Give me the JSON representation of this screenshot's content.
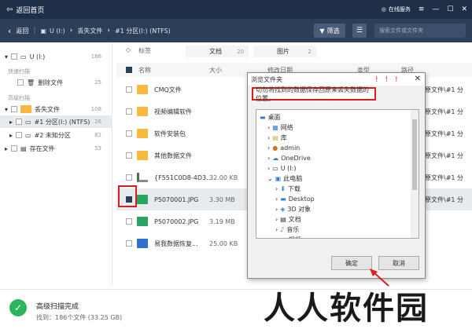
{
  "topbar": {
    "back_label": "返回首页",
    "service_label": "在线服务"
  },
  "navbar": {
    "back": "返回",
    "crumbs": [
      "U (I:)",
      "丢失文件",
      "#1 分区(I:) (NTFS)"
    ],
    "filter": "筛选",
    "search_placeholder": "搜索文件或文件夹"
  },
  "sidebar": {
    "drive": {
      "label": "U (I:)",
      "count": "186"
    },
    "quick_title": "快速扫描",
    "deleted": {
      "label": "删除文件",
      "count": "25"
    },
    "advanced_title": "高级扫描",
    "lost": {
      "label": "丢失文件",
      "count": "108"
    },
    "part1": {
      "label": "#1 分区(I:) (NTFS)",
      "count": "26"
    },
    "part2": {
      "label": "#2 未知分区",
      "count": "82"
    },
    "existing": {
      "label": "存在文件",
      "count": "53"
    }
  },
  "tabs": {
    "tag": "标签",
    "doc": "文档",
    "doc_count": "20",
    "pic": "图片",
    "pic_count": "2"
  },
  "columns": {
    "name": "名称",
    "size": "大小",
    "date": "修改日期",
    "type": "类型",
    "path": "路径"
  },
  "files": [
    {
      "name": "CMQ文件",
      "size": ""
    },
    {
      "name": "视频编辑软件",
      "size": ""
    },
    {
      "name": "软件安装包",
      "size": ""
    },
    {
      "name": "其他数据文件",
      "size": ""
    },
    {
      "name": "{F551C0D8-4D3...",
      "size": "32.00 KB"
    },
    {
      "name": "P5070001.JPG",
      "size": "3.30 MB"
    },
    {
      "name": "P5070002.JPG",
      "size": "3.19 MB"
    },
    {
      "name": "易我数据恢复...",
      "size": "25.00 KB"
    }
  ],
  "path_cells": [
    "原文件\\#1 分",
    "原文件\\#1 分",
    "原文件\\#1 分",
    "原文件\\#1 分",
    "原文件\\#1 分",
    "原文件\\#1 分"
  ],
  "dialog": {
    "title": "浏览文件夹",
    "message": "切勿将找到的数据保存回原来丢失数据的位置。",
    "exclaim": "! ! !",
    "tree": [
      "桌面",
      "网络",
      "库",
      "admin",
      "OneDrive",
      "U (I:)",
      "此电脑",
      "下载",
      "Desktop",
      "3D 对象",
      "文档",
      "音乐",
      "视频"
    ],
    "ok": "确定",
    "cancel": "取消"
  },
  "status": {
    "title": "高级扫描完成",
    "detail": "找到：186个文件 (33.25 GB)"
  },
  "watermark": "人人软件园",
  "colors": {
    "topbar": "#1e2f47",
    "navbar": "#2c3e58",
    "accent_red": "#d81e1e",
    "success": "#2db55d",
    "folder": "#f5b942"
  }
}
